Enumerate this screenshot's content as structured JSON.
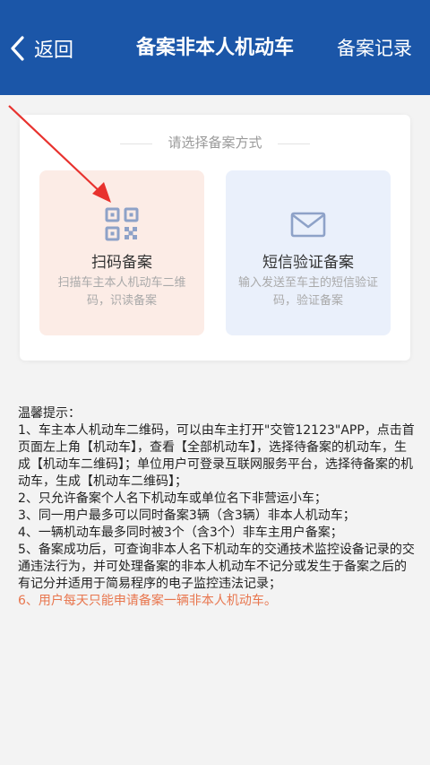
{
  "header": {
    "back_label": "返回",
    "title": "备案非本人机动车",
    "right_action": "备案记录"
  },
  "card": {
    "title": "请选择备案方式",
    "options": [
      {
        "label": "扫码备案",
        "description": "扫描车主本人机动车二维码，识读备案",
        "icon": "qr-code-icon"
      },
      {
        "label": "短信验证备案",
        "description": "输入发送至车主的短信验证码，验证备案",
        "icon": "envelope-icon"
      }
    ]
  },
  "tips": {
    "heading": "温馨提示：",
    "items": [
      "1、车主本人机动车二维码，可以由车主打开\"交管12123\"APP，点击首页面左上角【机动车】，查看【全部机动车】，选择待备案的机动车，生成【机动车二维码】；单位用户可登录互联网服务平台，选择待备案的机动车，生成【机动车二维码】；",
      "2、只允许备案个人名下机动车或单位名下非营运小车；",
      "3、同一用户最多可以同时备案3辆（含3辆）非本人机动车；",
      "4、一辆机动车最多同时被3个（含3个）非车主用户备案；",
      "5、备案成功后，可查询非本人名下机动车的交通技术监控设备记录的交通违法行为，并可处理备案的非本人机动车不记分或发生于备案之后的有记分并适用于简易程序的电子监控违法记录；",
      "6、用户每天只能申请备案一辆非本人机动车。"
    ]
  },
  "colors": {
    "header_bg": "#1b56a8",
    "page_bg": "#f3f3f3",
    "scan_option_bg": "#fcece6",
    "sms_option_bg": "#eaf0fb",
    "icon_blue": "#8ea2c8",
    "highlight_orange": "#e8764e",
    "annotation_arrow": "#e8322e"
  }
}
